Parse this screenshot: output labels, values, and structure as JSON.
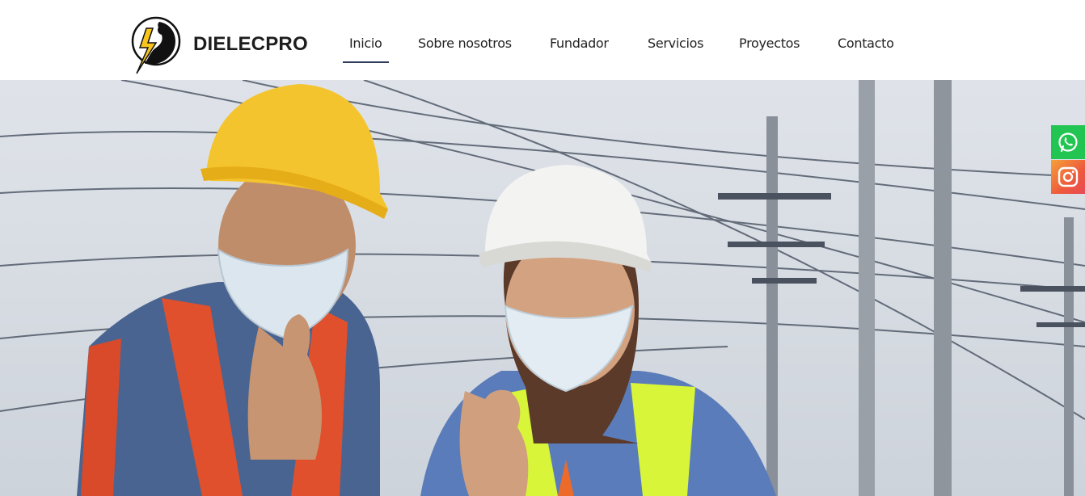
{
  "header": {
    "brand": "DIELECPRO",
    "logo_icon": "electrician-lightning-logo-icon"
  },
  "nav": {
    "items": [
      {
        "label": "Inicio",
        "active": true
      },
      {
        "label": "Sobre nosotros",
        "active": false
      },
      {
        "label": "Fundador",
        "active": false
      },
      {
        "label": "Servicios",
        "active": false
      },
      {
        "label": "Proyectos",
        "active": false
      },
      {
        "label": "Contacto",
        "active": false
      }
    ]
  },
  "hero": {
    "image": "two-workers-hard-hats-masks-thumbs-up-power-lines"
  },
  "social": {
    "whatsapp_icon": "whatsapp-icon",
    "instagram_icon": "instagram-icon",
    "colors": {
      "whatsapp": "#23c552",
      "instagram": "#ee5a3c"
    }
  },
  "colors": {
    "nav_underline": "#2d3a5a",
    "text": "#222222"
  }
}
